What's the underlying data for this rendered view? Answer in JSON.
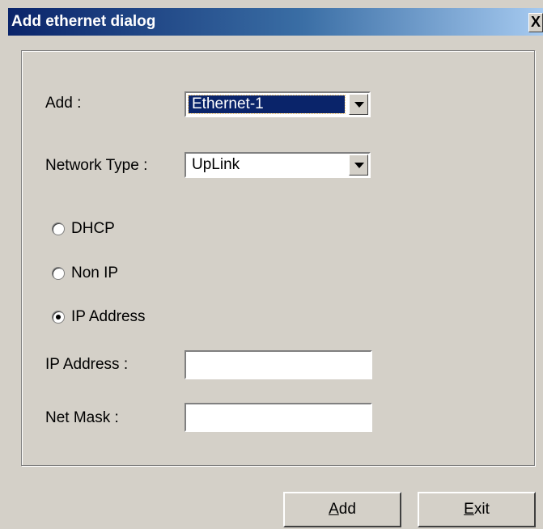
{
  "window": {
    "title": "Add ethernet dialog",
    "close_label": "X"
  },
  "form": {
    "add_label": "Add :",
    "add_value": "Ethernet-1",
    "network_type_label": "Network Type :",
    "network_type_value": "UpLink",
    "radios": [
      {
        "label": "DHCP",
        "checked": false
      },
      {
        "label": "Non IP",
        "checked": false
      },
      {
        "label": "IP Address",
        "checked": true
      }
    ],
    "ip_address_label": "IP Address :",
    "ip_address_value": "",
    "net_mask_label": "Net Mask :",
    "net_mask_value": ""
  },
  "buttons": {
    "add": "Add",
    "exit": "Exit"
  },
  "icons": {
    "dropdown": "chevron-down-icon",
    "close": "close-icon"
  }
}
